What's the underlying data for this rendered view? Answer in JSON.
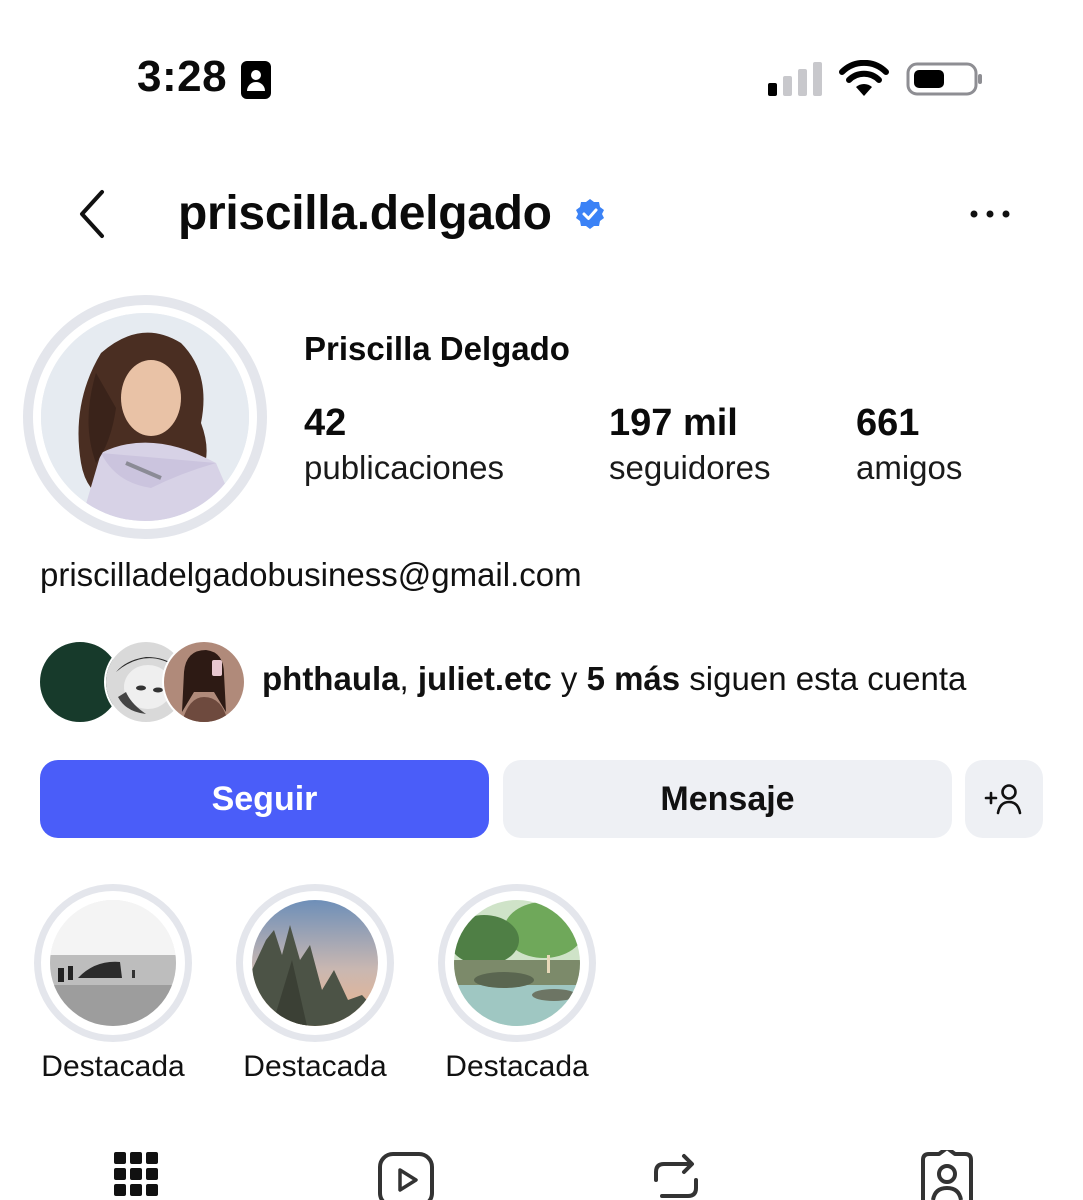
{
  "status_bar": {
    "time": "3:28"
  },
  "header": {
    "username": "priscilla.delgado"
  },
  "profile": {
    "full_name": "Priscilla Delgado",
    "stats": [
      {
        "value": "42",
        "label": "publicaciones"
      },
      {
        "value": "197 mil",
        "label": "seguidores"
      },
      {
        "value": "661",
        "label": "amigos"
      }
    ],
    "bio_email": "priscilladelgadobusiness@gmail.com"
  },
  "followed_by": {
    "user1": "phthaula",
    "sep": ", ",
    "user2": "juliet.etc",
    "conj": " y ",
    "more": "5 más",
    "suffix": " siguen esta cuenta"
  },
  "actions": {
    "follow_label": "Seguir",
    "message_label": "Mensaje"
  },
  "highlights": [
    {
      "label": "Destacada"
    },
    {
      "label": "Destacada"
    },
    {
      "label": "Destacada"
    }
  ],
  "tabs": [
    {
      "icon": "grid-icon"
    },
    {
      "icon": "reels-icon"
    },
    {
      "icon": "reposts-icon"
    },
    {
      "icon": "tagged-icon"
    }
  ],
  "colors": {
    "accent": "#4a5df9",
    "verified": "#3b82f6",
    "button_secondary": "#eef0f4"
  }
}
